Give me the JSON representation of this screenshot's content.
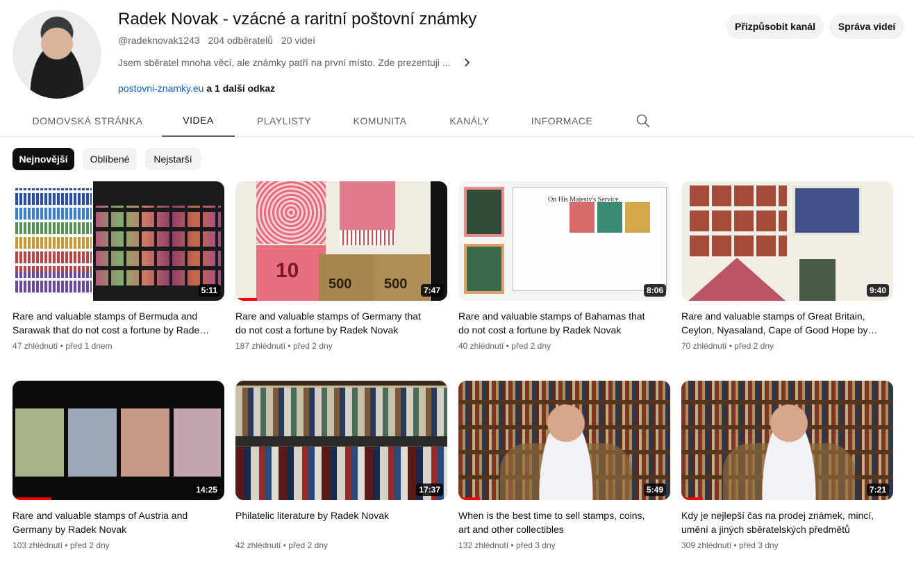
{
  "channel": {
    "name": "Radek Novak - vzácné a raritní poštovní známky",
    "handle": "@radeknovak1243",
    "subscribers": "204 odběratelů",
    "videos_count": "20 videí",
    "description": "Jsem sběratel mnoha věcí, ale známky patří na první místo. Zde prezentuji ...",
    "link": "postovni-znamky.eu",
    "more_links": "a 1 další odkaz"
  },
  "actions": {
    "customize": "Přizpůsobit kanál",
    "manage": "Správa videí"
  },
  "tabs": [
    "DOMOVSKÁ STRÁNKA",
    "VIDEA",
    "PLAYLISTY",
    "KOMUNITA",
    "KANÁLY",
    "INFORMACE"
  ],
  "active_tab": "VIDEA",
  "chips": [
    "Nejnovější",
    "Oblíbené",
    "Nejstarší"
  ],
  "active_chip": "Nejnovější",
  "videos": [
    {
      "title": "Rare and valuable stamps of Bermuda and Sarawak that do not cost a fortune by Radek Novak",
      "duration": "5:11",
      "views": "47 zhlédnutí",
      "age": "před 1 dnem",
      "watched": 0
    },
    {
      "title": "Rare and valuable stamps of Germany that do not cost a fortune by Radek Novak",
      "duration": "7:47",
      "views": "187 zhlédnutí",
      "age": "před 2 dny",
      "watched": 0.1
    },
    {
      "title": "Rare and valuable stamps of Bahamas that do not cost a fortune by Radek Novak",
      "duration": "8:06",
      "views": "40 zhlédnutí",
      "age": "před 2 dny",
      "watched": 0
    },
    {
      "title": "Rare and valuable stamps of Great Britain, Ceylon, Nyasaland, Cape of Good Hope by Radek Novak",
      "duration": "9:40",
      "views": "70 zhlédnutí",
      "age": "před 2 dny",
      "watched": 0
    },
    {
      "title": "Rare and valuable stamps of Austria and Germany by Radek Novak",
      "duration": "14:25",
      "views": "103 zhlédnutí",
      "age": "před 2 dny",
      "watched": 0.18
    },
    {
      "title": "Philatelic literature by Radek Novak",
      "duration": "17:37",
      "views": "42 zhlédnutí",
      "age": "před 2 dny",
      "watched": 0
    },
    {
      "title": "When is the best time to sell stamps, coins, art and other collectibles",
      "duration": "5:49",
      "views": "132 zhlédnutí",
      "age": "před 3 dny",
      "watched": 0.1
    },
    {
      "title": "Kdy je nejlepší čas na prodej známek, mincí, umění a jiných sběratelských předmětů",
      "duration": "7:21",
      "views": "309 zhlédnutí",
      "age": "před 3 dny",
      "watched": 0.1
    }
  ],
  "separator": "•",
  "icons": [
    "avatar",
    "chevron-right-icon",
    "search-icon"
  ],
  "colors": {
    "link": "#065fd4",
    "progress": "#ff0000",
    "chip_active_bg": "#0f0f0f"
  }
}
